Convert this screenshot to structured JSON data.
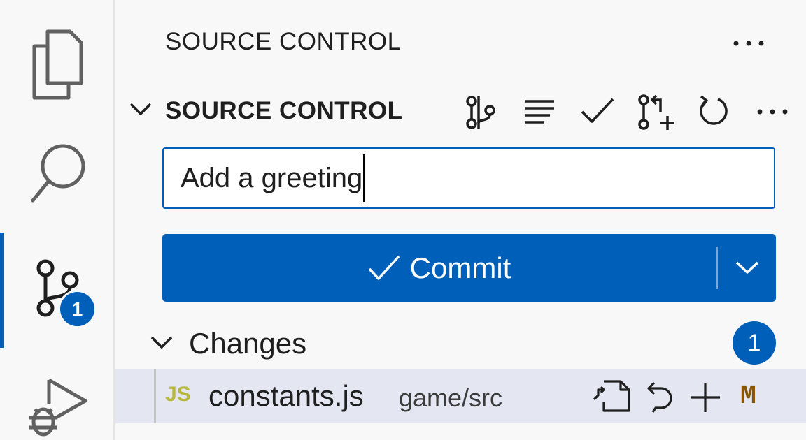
{
  "activity_bar": {
    "items": [
      {
        "name": "explorer",
        "icon": "files-icon"
      },
      {
        "name": "search",
        "icon": "search-icon"
      },
      {
        "name": "source-control",
        "icon": "source-control-icon",
        "badge": "1",
        "active": true
      },
      {
        "name": "run-and-debug",
        "icon": "debug-icon"
      }
    ]
  },
  "panel": {
    "title": "SOURCE CONTROL",
    "more_icon": "ellipsis-icon"
  },
  "section": {
    "title": "SOURCE CONTROL",
    "toolbar_icons": [
      "git-graph-icon",
      "list-view-icon",
      "check-icon",
      "pull-request-icon",
      "refresh-icon",
      "ellipsis-icon"
    ]
  },
  "commit_message": {
    "value": "Add a greeting"
  },
  "commit_button": {
    "label": "Commit",
    "icon": "check-icon",
    "dropdown_icon": "chevron-down-icon"
  },
  "changes": {
    "label": "Changes",
    "count": "1",
    "files": [
      {
        "icon_label": "JS",
        "name": "constants.js",
        "path": "game/src",
        "status": "M",
        "actions": [
          "open-file-icon",
          "discard-changes-icon",
          "stage-changes-icon"
        ]
      }
    ]
  },
  "colors": {
    "accent": "#005fb8",
    "background": "#f8f8f8",
    "selected_row": "#e4e6f1",
    "js_icon": "#b7b73b",
    "modified": "#895503"
  }
}
